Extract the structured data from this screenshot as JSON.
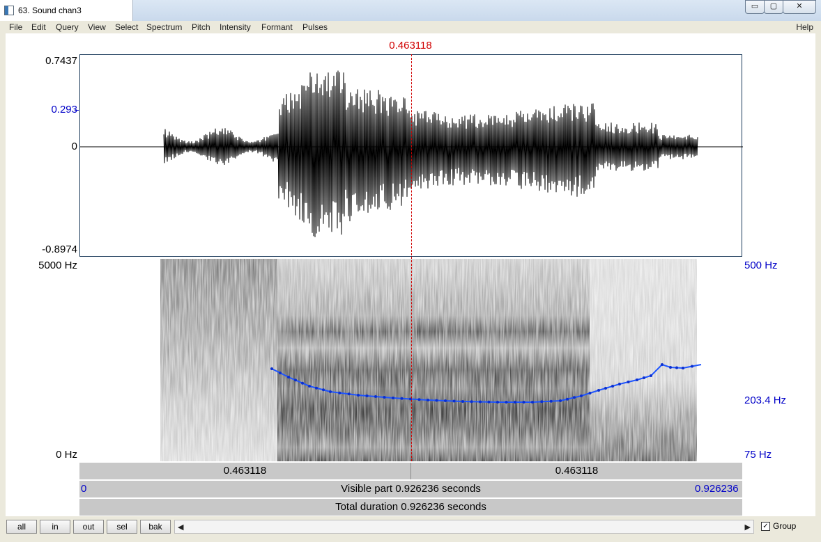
{
  "window": {
    "title": "63. Sound chan3",
    "minimize_label": "▭",
    "maximize_label": "▢",
    "close_label": "✕"
  },
  "menu": [
    "File",
    "Edit",
    "Query",
    "View",
    "Select",
    "Spectrum",
    "Pitch",
    "Intensity",
    "Formant",
    "Pulses"
  ],
  "menu_help": "Help",
  "cursor_time": "0.463118",
  "waveform": {
    "y_max": "0.7437",
    "y_cursor": "0.293",
    "y_zero": "0",
    "y_min": "-0.8974"
  },
  "spectrogram": {
    "freq_top": "5000 Hz",
    "freq_bottom": "0 Hz",
    "pitch_top": "500 Hz",
    "pitch_cursor": "203.4 Hz",
    "pitch_bottom": "75 Hz"
  },
  "time_bar": {
    "left_segment": "0.463118",
    "right_segment": "0.463118",
    "start": "0",
    "visible_text": "Visible part 0.926236 seconds",
    "end": "0.926236",
    "total_text": "Total duration 0.926236 seconds"
  },
  "buttons": [
    "all",
    "in",
    "out",
    "sel",
    "bak"
  ],
  "scroll": {
    "left_arrow": "◀",
    "right_arrow": "▶"
  },
  "group": {
    "label": "Group",
    "checked_glyph": "✓"
  },
  "colors": {
    "cursor": "#d00000",
    "pitch": "#0000c8",
    "pitch_line": "#1e55ff"
  }
}
